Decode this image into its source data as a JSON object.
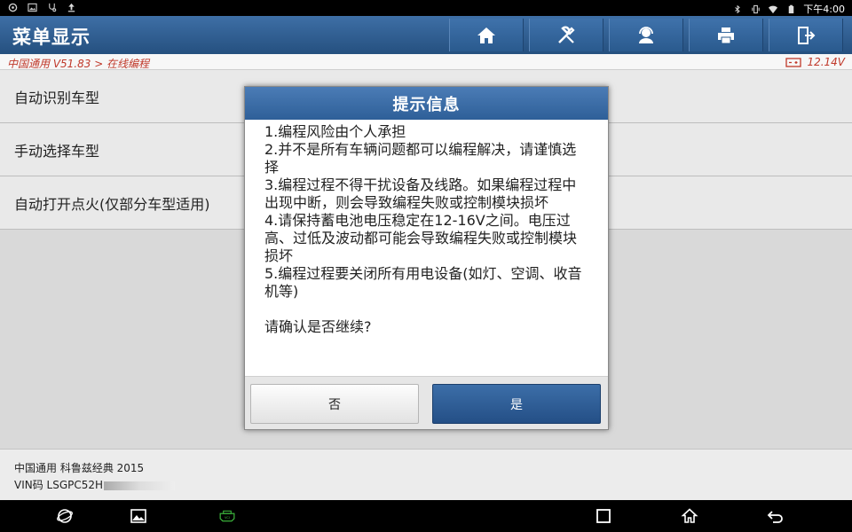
{
  "statusbar": {
    "time": "下午4:00"
  },
  "app": {
    "title": "菜单显示"
  },
  "toolbar": {
    "icons": [
      "home-icon",
      "tools-icon",
      "support-icon",
      "print-icon",
      "exit-icon"
    ]
  },
  "breadcrumb": {
    "path": "中国通用 V51.83 > 在线编程",
    "voltage": "12.14V"
  },
  "menu": {
    "items": [
      {
        "label": "自动识别车型"
      },
      {
        "label": "手动选择车型"
      },
      {
        "label": "自动打开点火(仅部分车型适用)"
      }
    ]
  },
  "dialog": {
    "title": "提示信息",
    "lines": [
      "1.编程风险由个人承担",
      "2.并不是所有车辆问题都可以编程解决，请谨慎选择",
      "3.编程过程不得干扰设备及线路。如果编程过程中出现中断，则会导致编程失败或控制模块损坏",
      "4.请保持蓄电池电压稳定在12-16V之间。电压过高、过低及波动都可能会导致编程失败或控制模块损坏",
      "5.编程过程要关闭所有用电设备(如灯、空调、收音机等)"
    ],
    "confirm": "请确认是否继续?",
    "no_label": "否",
    "yes_label": "是"
  },
  "vehicle": {
    "model": "中国通用 科鲁兹经典 2015",
    "vin_prefix": "VIN码 LSGPC52H"
  },
  "colors": {
    "header_blue": "#2e5f98",
    "accent_red": "#c0392b"
  }
}
